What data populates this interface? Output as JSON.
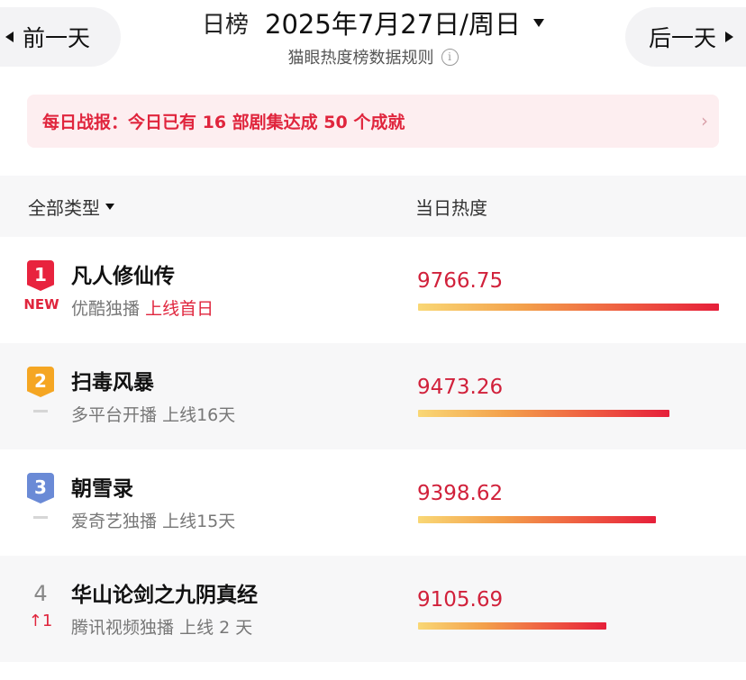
{
  "header": {
    "prev_label": "前一天",
    "next_label": "后一天",
    "chart_kind": "日榜",
    "date_label": "2025年7月27日/周日",
    "rules_label": "猫眼热度榜数据规则",
    "info_glyph": "i"
  },
  "banner": {
    "text": "每日战报：今日已有 16 部剧集达成 50 个成就",
    "arrow": "›"
  },
  "table": {
    "filter_label": "全部类型",
    "heat_col_label": "当日热度"
  },
  "rows": [
    {
      "rank": "1",
      "trend": "NEW",
      "name": "凡人修仙传",
      "platform": "优酷独播",
      "status": "上线首日",
      "heat": "9766.75",
      "heat_value": 9766.75
    },
    {
      "rank": "2",
      "trend": "",
      "name": "扫毒风暴",
      "platform": "多平台开播",
      "status": "上线16天",
      "heat": "9473.26",
      "heat_value": 9473.26
    },
    {
      "rank": "3",
      "trend": "",
      "name": "朝雪录",
      "platform": "爱奇艺独播",
      "status": "上线15天",
      "heat": "9398.62",
      "heat_value": 9398.62
    },
    {
      "rank": "4",
      "trend": "1",
      "name": "华山论剑之九阴真经",
      "platform": "腾讯视频独播",
      "status": "上线 2 天",
      "heat": "9105.69",
      "heat_value": 9105.69
    }
  ],
  "colors": {
    "accent": "#e0253d",
    "rank1": "#e8233e",
    "rank2": "#f5a623",
    "rank3": "#6a8ad6"
  }
}
